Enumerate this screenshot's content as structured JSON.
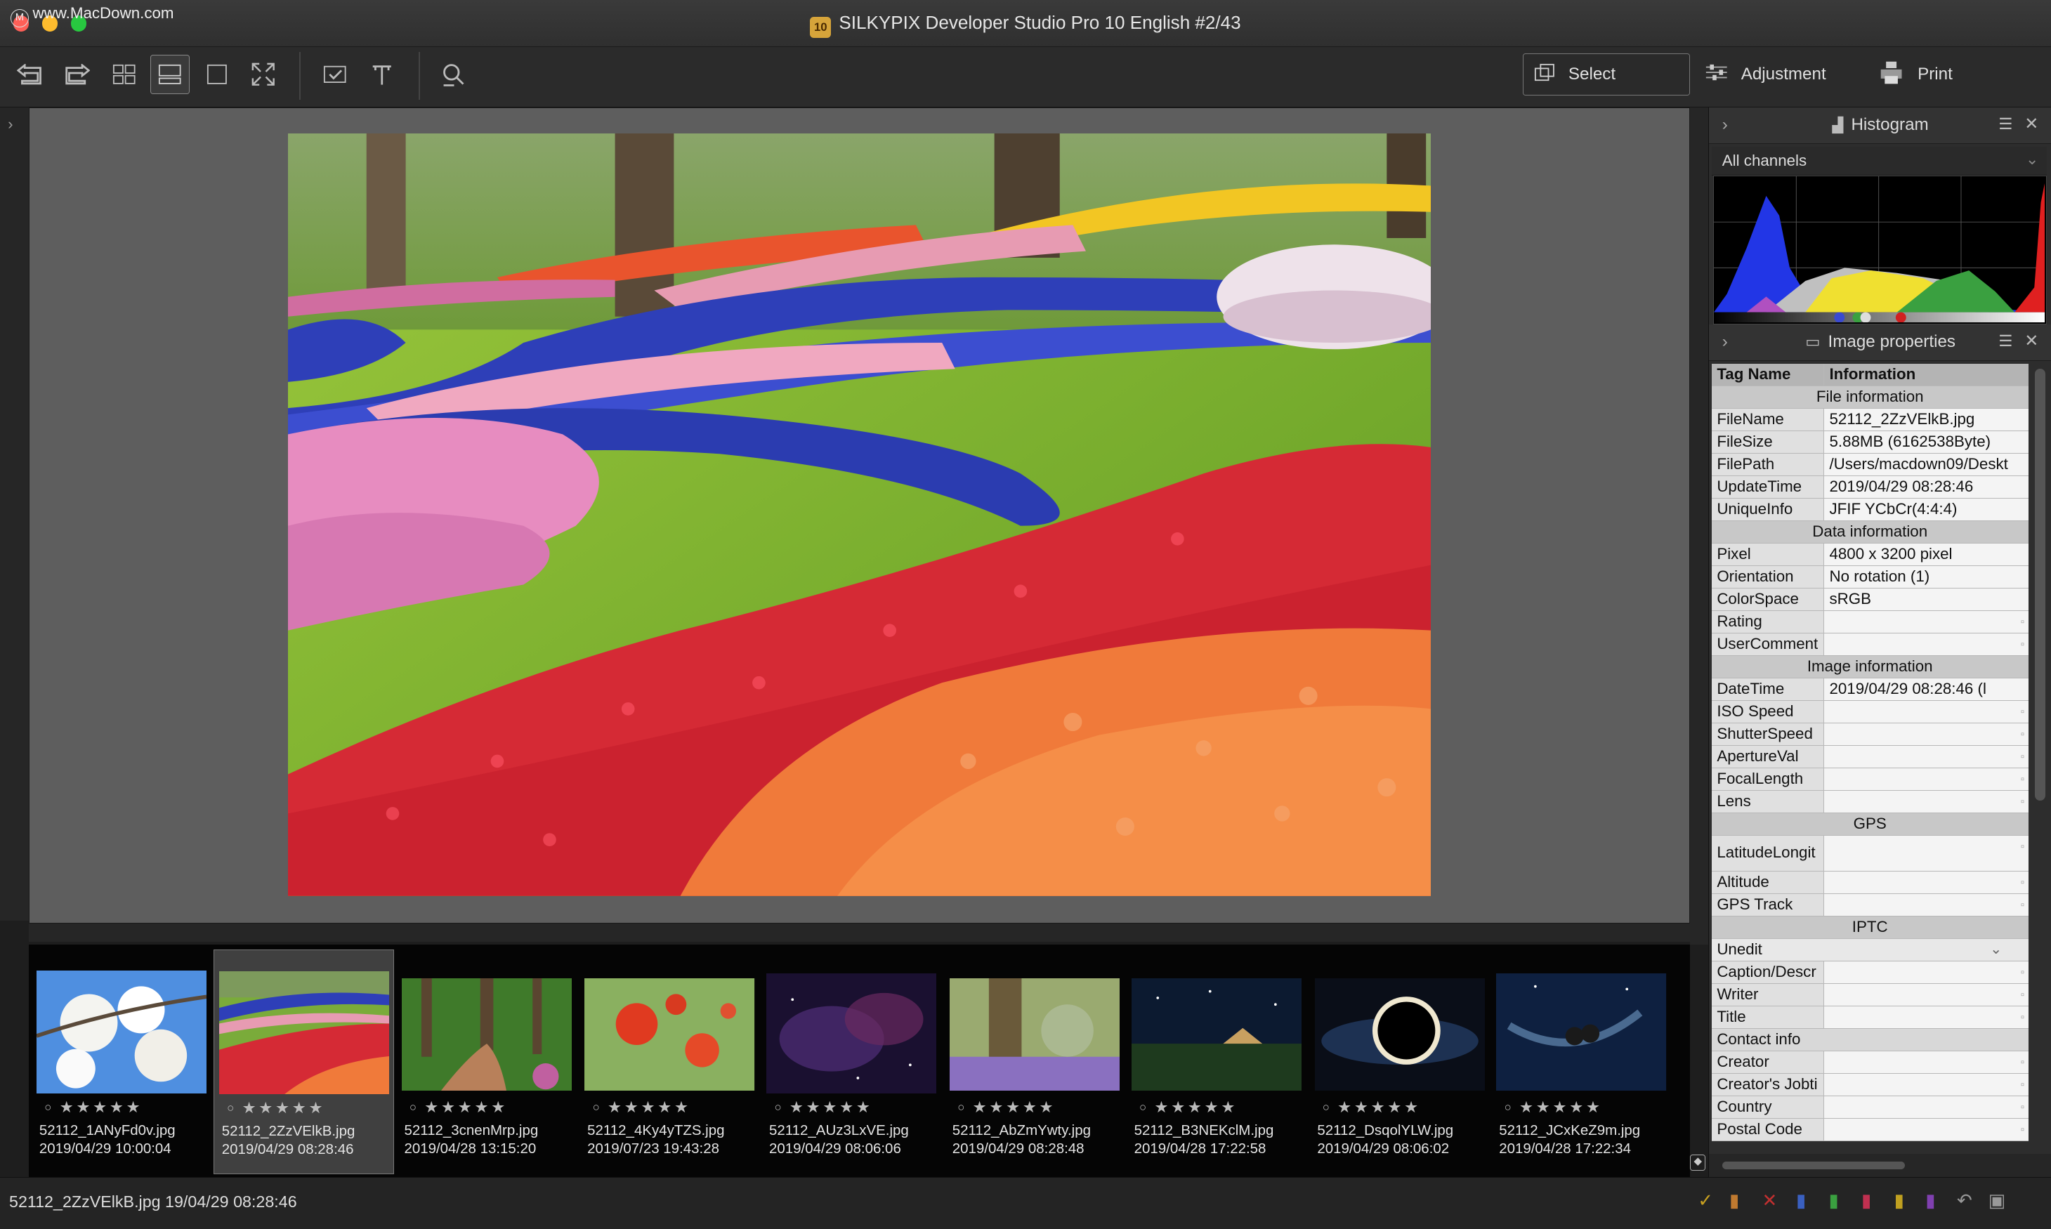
{
  "window": {
    "watermark": "www.MacDown.com",
    "app_badge": "10",
    "title": "SILKYPIX Developer Studio Pro 10 English   #2/43"
  },
  "toolbar": {
    "modes": [
      {
        "label": "Select",
        "icon": "select-icon"
      },
      {
        "label": "Adjustment",
        "icon": "adjustment-icon"
      },
      {
        "label": "Print",
        "icon": "print-icon"
      }
    ]
  },
  "histogram": {
    "title": "Histogram",
    "channel": "All channels"
  },
  "properties": {
    "title": "Image properties",
    "header": {
      "k": "Tag Name",
      "v": "Information"
    },
    "rows": [
      {
        "type": "sec",
        "label": "File information"
      },
      {
        "k": "FileName",
        "v": "52112_2ZzVElkB.jpg"
      },
      {
        "k": "FileSize",
        "v": "5.88MB (6162538Byte)"
      },
      {
        "k": "FilePath",
        "v": "/Users/macdown09/Deskt"
      },
      {
        "k": "UpdateTime",
        "v": "2019/04/29 08:28:46"
      },
      {
        "k": "UniqueInfo",
        "v": "JFIF YCbCr(4:4:4)"
      },
      {
        "type": "sec",
        "label": "Data information"
      },
      {
        "k": "Pixel",
        "v": "4800 x 3200 pixel"
      },
      {
        "k": "Orientation",
        "v": "No rotation (1)"
      },
      {
        "k": "ColorSpace",
        "v": "sRGB"
      },
      {
        "k": "Rating",
        "v": "",
        "edit": true
      },
      {
        "k": "UserComment",
        "v": "",
        "edit": true
      },
      {
        "type": "sec",
        "label": "Image information"
      },
      {
        "k": "DateTime",
        "v": "2019/04/29 08:28:46 (l"
      },
      {
        "k": "ISO Speed",
        "v": "",
        "edit": true
      },
      {
        "k": "ShutterSpeed",
        "v": "",
        "edit": true
      },
      {
        "k": "ApertureVal",
        "v": "",
        "edit": true
      },
      {
        "k": "FocalLength",
        "v": "",
        "edit": true
      },
      {
        "k": "Lens",
        "v": "",
        "edit": true
      },
      {
        "type": "sec",
        "label": "GPS"
      },
      {
        "k": "LatitudeLongit",
        "v": "",
        "edit": true,
        "tall": true
      },
      {
        "k": "Altitude",
        "v": "",
        "edit": true
      },
      {
        "k": "GPS Track",
        "v": "",
        "edit": true
      },
      {
        "type": "sec",
        "label": "IPTC"
      },
      {
        "type": "select",
        "label": "Unedit"
      },
      {
        "k": "Caption/Descr",
        "v": "",
        "edit": true
      },
      {
        "k": "Writer",
        "v": "",
        "edit": true
      },
      {
        "k": "Title",
        "v": "",
        "edit": true
      },
      {
        "type": "plain",
        "label": "Contact info"
      },
      {
        "k": "Creator",
        "v": "",
        "edit": true
      },
      {
        "k": "Creator's Jobti",
        "v": "",
        "edit": true
      },
      {
        "k": "Country",
        "v": "",
        "edit": true
      },
      {
        "k": "Postal Code",
        "v": "",
        "edit": true
      }
    ]
  },
  "filmstrip": [
    {
      "name": "52112_1ANyFd0v.jpg",
      "date": "2019/04/29 10:00:04",
      "theme": "blossom"
    },
    {
      "name": "52112_2ZzVElkB.jpg",
      "date": "2019/04/29 08:28:46",
      "theme": "tulips",
      "selected": true
    },
    {
      "name": "52112_3cnenMrp.jpg",
      "date": "2019/04/28 13:15:20",
      "theme": "forest"
    },
    {
      "name": "52112_4Ky4yTZS.jpg",
      "date": "2019/07/23 19:43:28",
      "theme": "poppy"
    },
    {
      "name": "52112_AUz3LxVE.jpg",
      "date": "2019/04/29 08:06:06",
      "theme": "nebula"
    },
    {
      "name": "52112_AbZmYwty.jpg",
      "date": "2019/04/29 08:28:48",
      "theme": "crocus"
    },
    {
      "name": "52112_B3NEKclM.jpg",
      "date": "2019/04/28 17:22:58",
      "theme": "night"
    },
    {
      "name": "52112_DsqolYLW.jpg",
      "date": "2019/04/29 08:06:02",
      "theme": "eclipse"
    },
    {
      "name": "52112_JCxKeZ9m.jpg",
      "date": "2019/04/28 17:22:34",
      "theme": "hammock"
    }
  ],
  "status": {
    "text": "52112_2ZzVElkB.jpg 19/04/29 08:28:46"
  }
}
